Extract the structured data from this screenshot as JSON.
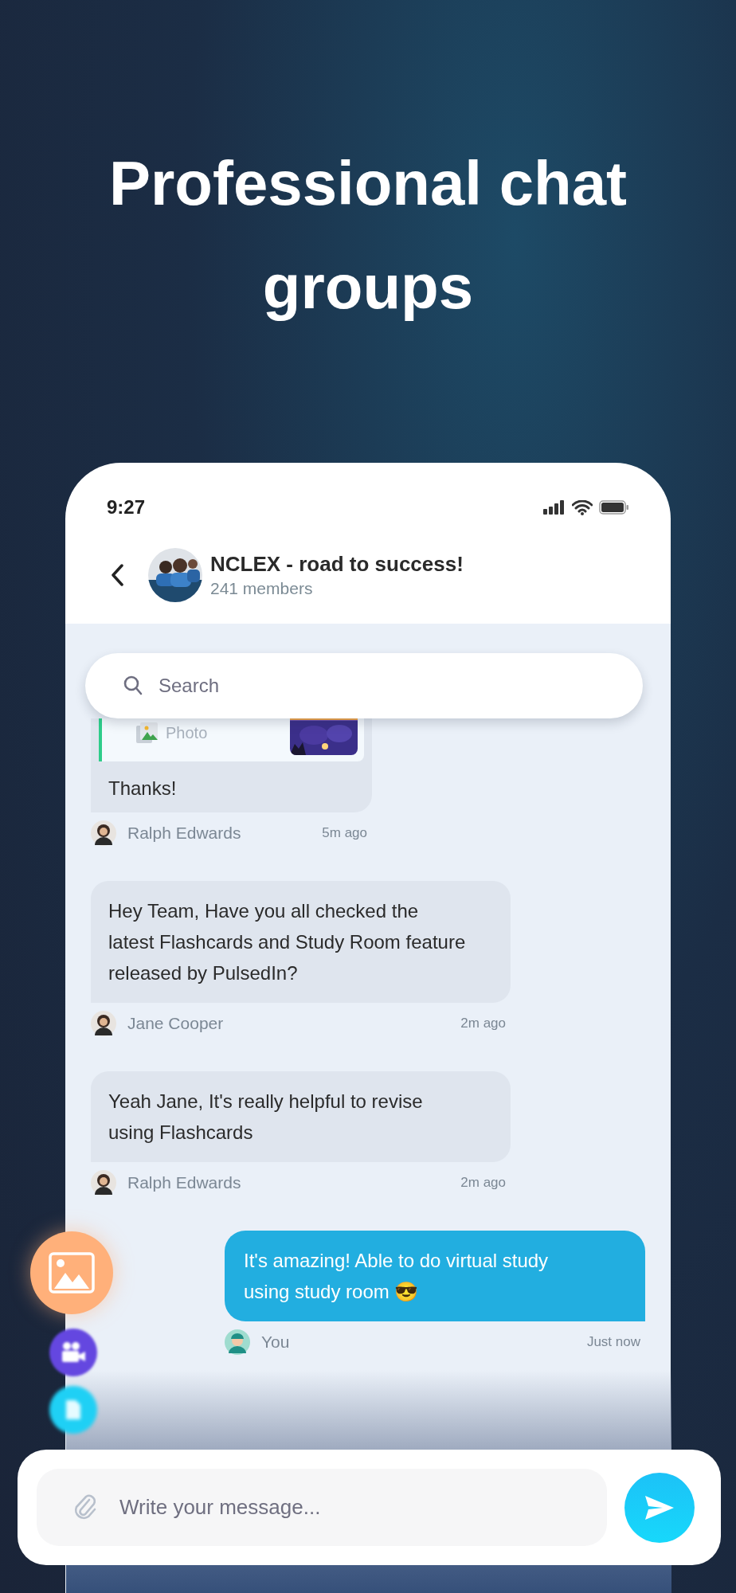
{
  "headline": "Professional chat groups",
  "status_bar": {
    "time": "9:27"
  },
  "header": {
    "title": "NCLEX - road to success!",
    "subtitle": "241 members"
  },
  "search": {
    "placeholder": "Search"
  },
  "messages": [
    {
      "kind": "photo_reply",
      "mine": false,
      "preview_label": "Photo",
      "text": "Thanks!",
      "sender": "Ralph Edwards",
      "time": "5m ago"
    },
    {
      "kind": "text",
      "mine": false,
      "text": "Hey Team, Have you all checked the latest Flashcards and Study Room feature released by PulsedIn?",
      "sender": "Jane Cooper",
      "time": "2m ago"
    },
    {
      "kind": "text",
      "mine": false,
      "text": "Yeah Jane, It's really helpful to revise using Flashcards",
      "sender": "Ralph Edwards",
      "time": "2m ago"
    },
    {
      "kind": "text",
      "mine": true,
      "text": "It's amazing! Able to do virtual study using study room 😎",
      "sender": "You",
      "time": "Just now"
    }
  ],
  "composer": {
    "placeholder": "Write your message..."
  }
}
